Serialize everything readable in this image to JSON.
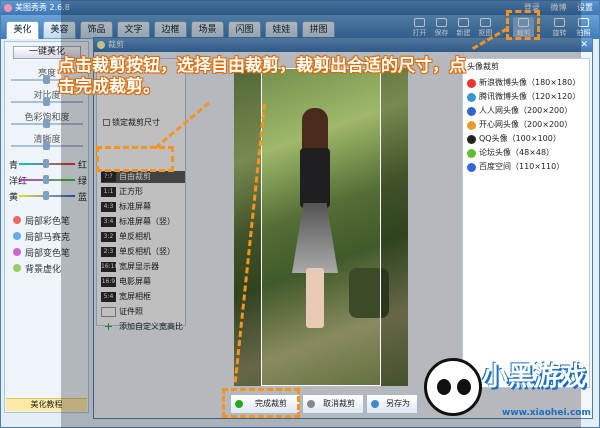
{
  "app": {
    "title": "美图秀秀 2.6.8",
    "top_links": [
      "登录",
      "微博",
      "设置"
    ]
  },
  "tabs": [
    "美化",
    "美容",
    "饰品",
    "文字",
    "边框",
    "场景",
    "闪图",
    "娃娃",
    "拼图"
  ],
  "toolbar": {
    "open": "打开",
    "save": "保存",
    "new": "新建",
    "paste": "抠图",
    "crop": "裁剪",
    "rotate": "旋转",
    "camera": "拍照"
  },
  "left_panel": {
    "one_key": "一键美化",
    "sliders": [
      "亮度",
      "对比度",
      "色彩饱和度",
      "清晰度"
    ],
    "color_balance": [
      [
        "青",
        "红"
      ],
      [
        "洋红",
        "绿"
      ],
      [
        "黄",
        "蓝"
      ]
    ],
    "effects": [
      "局部彩色笔",
      "局部马赛克",
      "局部变色笔",
      "背景虚化"
    ],
    "tutorial": "美化教程"
  },
  "dialog": {
    "title": "裁剪",
    "lock_label": "锁定裁剪尺寸",
    "ratios": [
      {
        "tag": "?:?",
        "label": "自由裁剪"
      },
      {
        "tag": "1:1",
        "label": "正方形"
      },
      {
        "tag": "4:3",
        "label": "标准屏幕"
      },
      {
        "tag": "3:4",
        "label": "标准屏幕（竖）"
      },
      {
        "tag": "3:2",
        "label": "单反相机"
      },
      {
        "tag": "2:3",
        "label": "单反相机（竖）"
      },
      {
        "tag": "16:10",
        "label": "宽屏显示器"
      },
      {
        "tag": "16:9",
        "label": "电影屏幕"
      },
      {
        "tag": "5:4",
        "label": "宽屏相框"
      },
      {
        "tag": "",
        "label": "证件照"
      },
      {
        "tag": "+",
        "label": "添加自定义宽高比"
      }
    ],
    "avatar_header": "头像裁剪",
    "avatars": [
      "新浪微博头像（180×180）",
      "腾讯微博头像（120×120）",
      "人人网头像（200×200）",
      "开心网头像（200×200）",
      "QQ头像（100×100）",
      "论坛头像（48×48）",
      "百度空间（110×110）"
    ],
    "buttons": {
      "done": "完成裁剪",
      "cancel": "取消裁剪",
      "save_as": "另存为"
    }
  },
  "instruction": "点击裁剪按钮，选择自由裁剪，裁剪出合适的尺寸，点击完成裁剪。",
  "branding": {
    "name": "小黑游戏",
    "url": "www.xiaohei.com"
  },
  "colors": {
    "accent": "#f7931e",
    "title_blue": "#3f78b6"
  }
}
